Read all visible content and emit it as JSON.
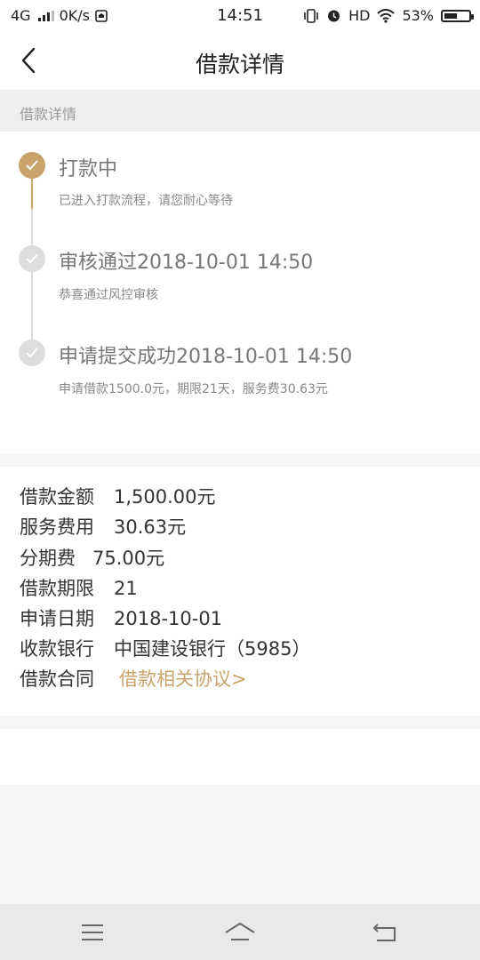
{
  "status_bar": {
    "network": "4G",
    "speed": "0K/s",
    "time": "14:51",
    "hd": "HD",
    "battery_percent": "53%",
    "battery_level": 0.53
  },
  "header": {
    "title": "借款详情"
  },
  "section": {
    "label": "借款详情"
  },
  "timeline": {
    "accent_color": "#c9a36a",
    "inactive_color": "#dddddd",
    "steps": [
      {
        "title": "打款中",
        "desc": "已进入打款流程，请您耐心等待",
        "active": true
      },
      {
        "title": "审核通过2018-10-01 14:50",
        "desc": "恭喜通过风控审核",
        "active": false
      },
      {
        "title": "申请提交成功2018-10-01 14:50",
        "desc": "申请借款1500.0元，期限21天，服务费30.63元",
        "active": false
      }
    ]
  },
  "details": {
    "rows": [
      {
        "key": "借款金额",
        "value": "1,500.00元"
      },
      {
        "key": "服务费用",
        "value": "30.63元"
      },
      {
        "key": "分期费",
        "value": "75.00元"
      },
      {
        "key": "借款期限",
        "value": "21"
      },
      {
        "key": "申请日期",
        "value": "2018-10-01"
      },
      {
        "key": "收款银行",
        "value": "中国建设银行（5985）"
      }
    ],
    "contract_key": "借款合同",
    "contract_link": "借款相关协议>"
  }
}
